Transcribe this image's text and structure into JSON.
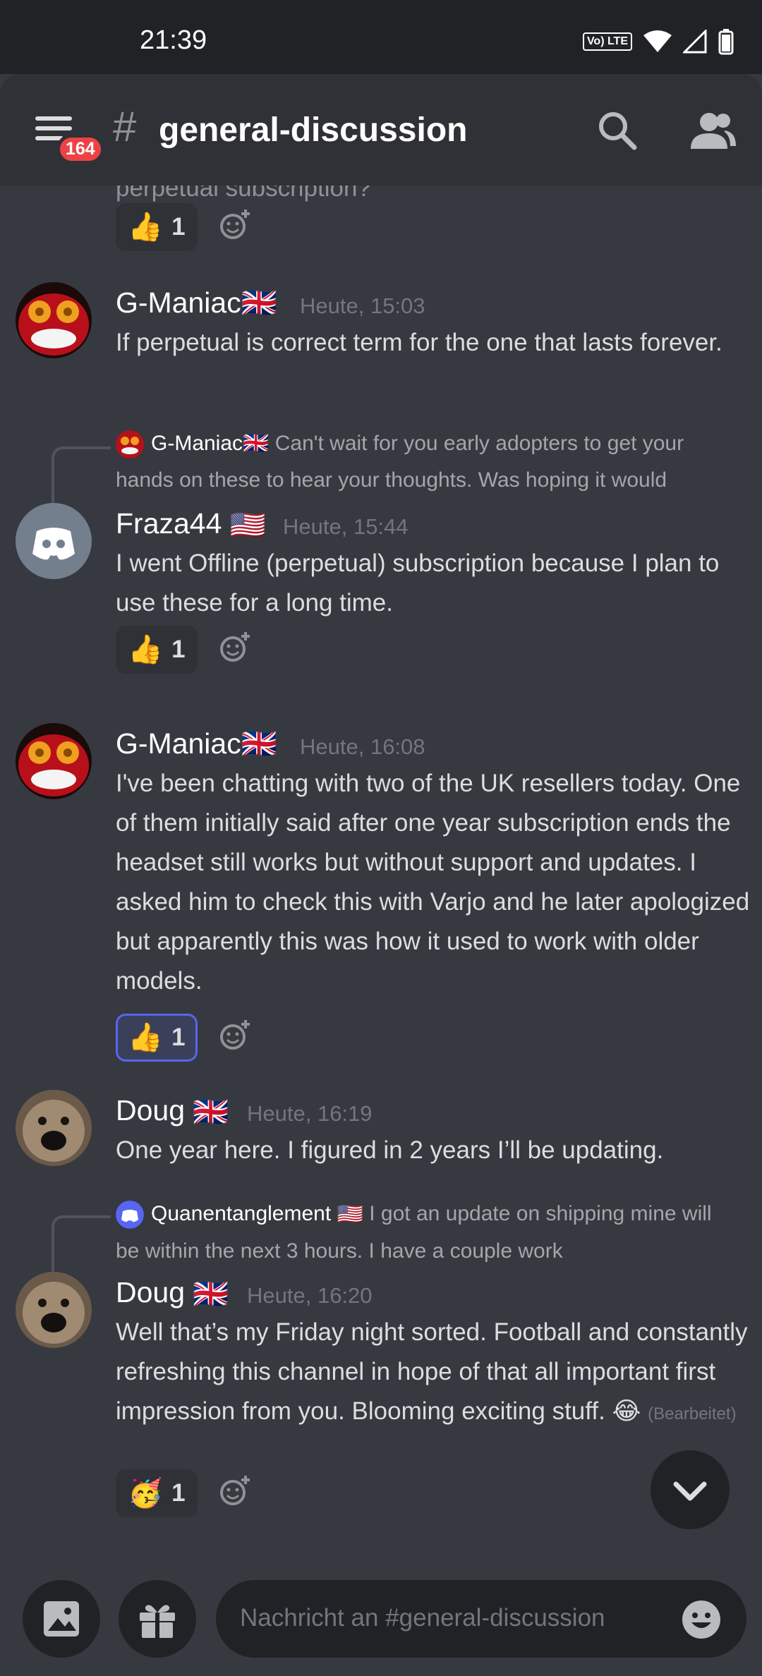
{
  "status_bar": {
    "time": "21:39",
    "volte": "Vo) LTE"
  },
  "header": {
    "badge_count": "164",
    "hash": "#",
    "channel_name": "general-discussion"
  },
  "messages": [
    {
      "truncated_text": "perpetual subscription?",
      "reaction": {
        "emoji": "👍",
        "count": "1"
      }
    },
    {
      "author": "G-Maniac🇬🇧",
      "time": "Heute, 15:03",
      "text": "If perpetual is correct term for the one that lasts forever."
    },
    {
      "reply": {
        "author": "G-Maniac🇬🇧",
        "text": "Can't wait for you early adopters to get your hands on these to hear your thoughts. Was hoping it would"
      },
      "author": "Fraza44",
      "flag": "🇺🇸",
      "time": "Heute, 15:44",
      "text": "I went Offline (perpetual) subscription because I plan to use these for a long time.",
      "reaction": {
        "emoji": "👍",
        "count": "1"
      }
    },
    {
      "author": "G-Maniac🇬🇧",
      "time": "Heute, 16:08",
      "text": "I've been chatting with two of the UK resellers today. One of them initially said after one year subscription ends  the headset still works but without support and updates. I asked him to check this with Varjo and he later apologized but apparently this was how it used to work with older models.",
      "reaction": {
        "emoji": "👍",
        "count": "1"
      }
    },
    {
      "author": "Doug",
      "flag": "🇬🇧",
      "time": "Heute, 16:19",
      "text": "One year here. I figured in 2 years I’ll be updating."
    },
    {
      "reply": {
        "author": "Quanentanglement",
        "flag": "🇺🇸",
        "text": "I got an update on shipping mine will be within the next 3 hours. I have a couple work"
      },
      "author": "Doug",
      "flag": "🇬🇧",
      "time": "Heute, 16:20",
      "text": "Well that’s my Friday night sorted. Football and constantly refreshing this channel in hope of that all important first impression from you. Blooming exciting stuff. 😂",
      "edited": "(Bearbeitet)",
      "reaction": {
        "emoji": "🥳",
        "count": "1"
      }
    }
  ],
  "composer": {
    "placeholder": "Nachricht an #general-discussion"
  },
  "colors": {
    "background": "#36393f",
    "header": "#2f3136",
    "accent": "#5865f2",
    "badge": "#ed4245"
  }
}
